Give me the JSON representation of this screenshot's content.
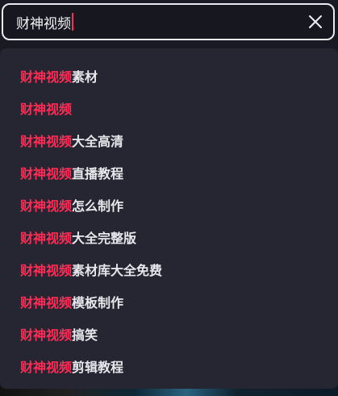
{
  "search": {
    "query": "财神视频",
    "accent_color": "#fe2c55"
  },
  "suggestions": [
    {
      "highlight": "财神视频",
      "rest": "素材"
    },
    {
      "highlight": "财神视频",
      "rest": ""
    },
    {
      "highlight": "财神视频",
      "rest": "大全高清"
    },
    {
      "highlight": "财神视频",
      "rest": "直播教程"
    },
    {
      "highlight": "财神视频",
      "rest": "怎么制作"
    },
    {
      "highlight": "财神视频",
      "rest": "大全完整版"
    },
    {
      "highlight": "财神视频",
      "rest": "素材库大全免费"
    },
    {
      "highlight": "财神视频",
      "rest": "模板制作"
    },
    {
      "highlight": "财神视频",
      "rest": "搞笑"
    },
    {
      "highlight": "财神视频",
      "rest": "剪辑教程"
    }
  ],
  "icons": {
    "clear": "close-icon"
  }
}
